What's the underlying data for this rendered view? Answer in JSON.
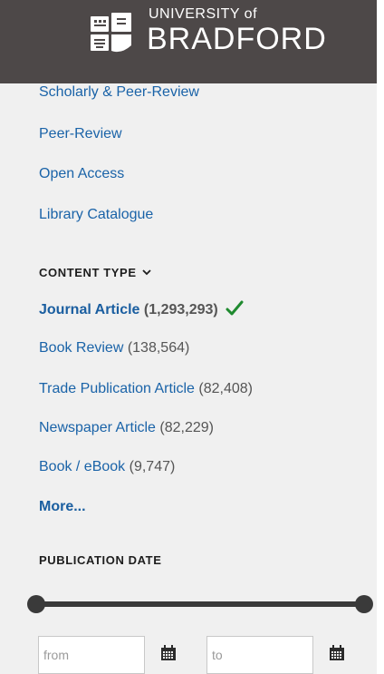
{
  "header": {
    "logo_top": "UNIVERSITY of",
    "logo_main": "BRADFORD",
    "background": "#4d4848"
  },
  "filters": {
    "quick_links": [
      {
        "label": "Scholarly & Peer-Review"
      },
      {
        "label": "Peer-Review"
      },
      {
        "label": "Open Access"
      },
      {
        "label": "Library Catalogue"
      }
    ],
    "content_type": {
      "heading": "CONTENT TYPE",
      "items": [
        {
          "label": "Journal Article",
          "count": "(1,293,293)",
          "selected": true
        },
        {
          "label": "Book Review",
          "count": "(138,564)"
        },
        {
          "label": "Trade Publication Article",
          "count": "(82,408)"
        },
        {
          "label": "Newspaper Article",
          "count": "(82,229)"
        },
        {
          "label": "Book / eBook",
          "count": "(9,747)"
        }
      ],
      "more_label": "More..."
    },
    "publication_date": {
      "heading": "PUBLICATION DATE",
      "from_placeholder": "from",
      "to_placeholder": "to"
    }
  },
  "colors": {
    "link": "#1a63a8",
    "count": "#555555",
    "check": "#1f8a2f",
    "panel": "#f0f0f0"
  },
  "icons": {
    "check": "check-icon",
    "chevron": "chevron-down-icon",
    "calendar": "calendar-icon",
    "logo": "university-crest-icon"
  }
}
